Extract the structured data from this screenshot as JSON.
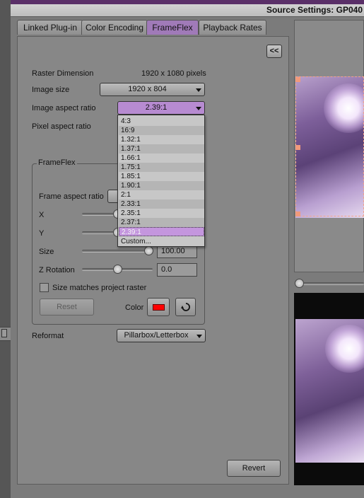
{
  "window": {
    "title": "Source Settings: GP040"
  },
  "tabs": [
    {
      "label": "Linked Plug-in"
    },
    {
      "label": "Color Encoding"
    },
    {
      "label": "FrameFlex"
    },
    {
      "label": "Playback Rates"
    }
  ],
  "active_tab": "FrameFlex",
  "panel": {
    "collapse_label": "<<",
    "raster_dimension": {
      "label": "Raster Dimension",
      "value": "1920 x 1080 pixels"
    },
    "image_size": {
      "label": "Image size",
      "value": "1920 x 804"
    },
    "image_aspect_ratio": {
      "label": "Image aspect ratio",
      "value": "2.39:1",
      "options": [
        "4:3",
        "16:9",
        "1.32:1",
        "1.37:1",
        "1.66:1",
        "1.75:1",
        "1.85:1",
        "1.90:1",
        "2:1",
        "2.33:1",
        "2.35:1",
        "2.37:1",
        "2.39:1",
        "Custom..."
      ]
    },
    "pixel_aspect_ratio": {
      "label": "Pixel aspect ratio"
    },
    "frameflex": {
      "title": "FrameFlex",
      "frame_aspect_ratio": {
        "label": "Frame aspect ratio"
      },
      "x": {
        "label": "X"
      },
      "y": {
        "label": "Y"
      },
      "size": {
        "label": "Size",
        "value": "100.00",
        "level": 0.95
      },
      "z_rotation": {
        "label": "Z Rotation",
        "value": "0.0",
        "level": 0.5
      },
      "size_matches": {
        "label": "Size matches project raster",
        "checked": false
      },
      "reset_label": "Reset",
      "color_label": "Color",
      "color_swatch": "#ff0000"
    },
    "reformat": {
      "label": "Reformat",
      "value": "Pillarbox/Letterbox"
    },
    "revert_label": "Revert"
  },
  "colors": {
    "accent": "#a07ab8",
    "selection_accent": "#c496de",
    "handle": "#f19a7c"
  }
}
